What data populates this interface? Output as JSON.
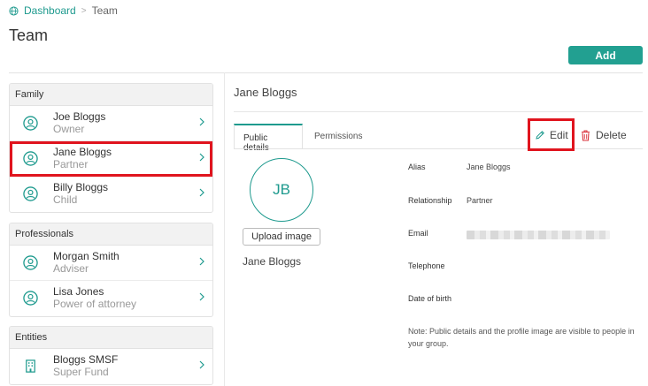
{
  "breadcrumb": {
    "home": "Dashboard",
    "separator": ">",
    "current": "Team"
  },
  "page_title": "Team",
  "add_label": "Add",
  "groups": {
    "family": {
      "title": "Family",
      "members": [
        {
          "name": "Joe Bloggs",
          "role": "Owner"
        },
        {
          "name": "Jane Bloggs",
          "role": "Partner"
        },
        {
          "name": "Billy Bloggs",
          "role": "Child"
        }
      ]
    },
    "professionals": {
      "title": "Professionals",
      "members": [
        {
          "name": "Morgan Smith",
          "role": "Adviser"
        },
        {
          "name": "Lisa Jones",
          "role": "Power of attorney"
        }
      ]
    },
    "entities": {
      "title": "Entities",
      "members": [
        {
          "name": "Bloggs SMSF",
          "role": "Super Fund"
        }
      ]
    }
  },
  "detail": {
    "name": "Jane Bloggs",
    "tabs": {
      "public": "Public details",
      "permissions": "Permissions"
    },
    "edit_label": "Edit",
    "delete_label": "Delete",
    "initials": "JB",
    "upload_label": "Upload image",
    "profile_name": "Jane Bloggs",
    "fields": {
      "alias": {
        "label": "Alias",
        "value": "Jane Bloggs"
      },
      "relationship": {
        "label": "Relationship",
        "value": "Partner"
      },
      "email": {
        "label": "Email"
      },
      "telephone": {
        "label": "Telephone"
      },
      "dob": {
        "label": "Date of birth"
      }
    },
    "note": "Note: Public details and the profile image are visible to people in your group."
  },
  "colors": {
    "accent": "#1e9a8e",
    "button": "#22a091",
    "highlight": "#e0141e",
    "delete": "#d9313a"
  },
  "icons": {
    "breadcrumb": "globe-icon",
    "member": "person-circle-icon",
    "entity": "building-icon",
    "row": "chevron-right-icon",
    "edit": "pencil-icon",
    "delete": "trash-icon"
  }
}
